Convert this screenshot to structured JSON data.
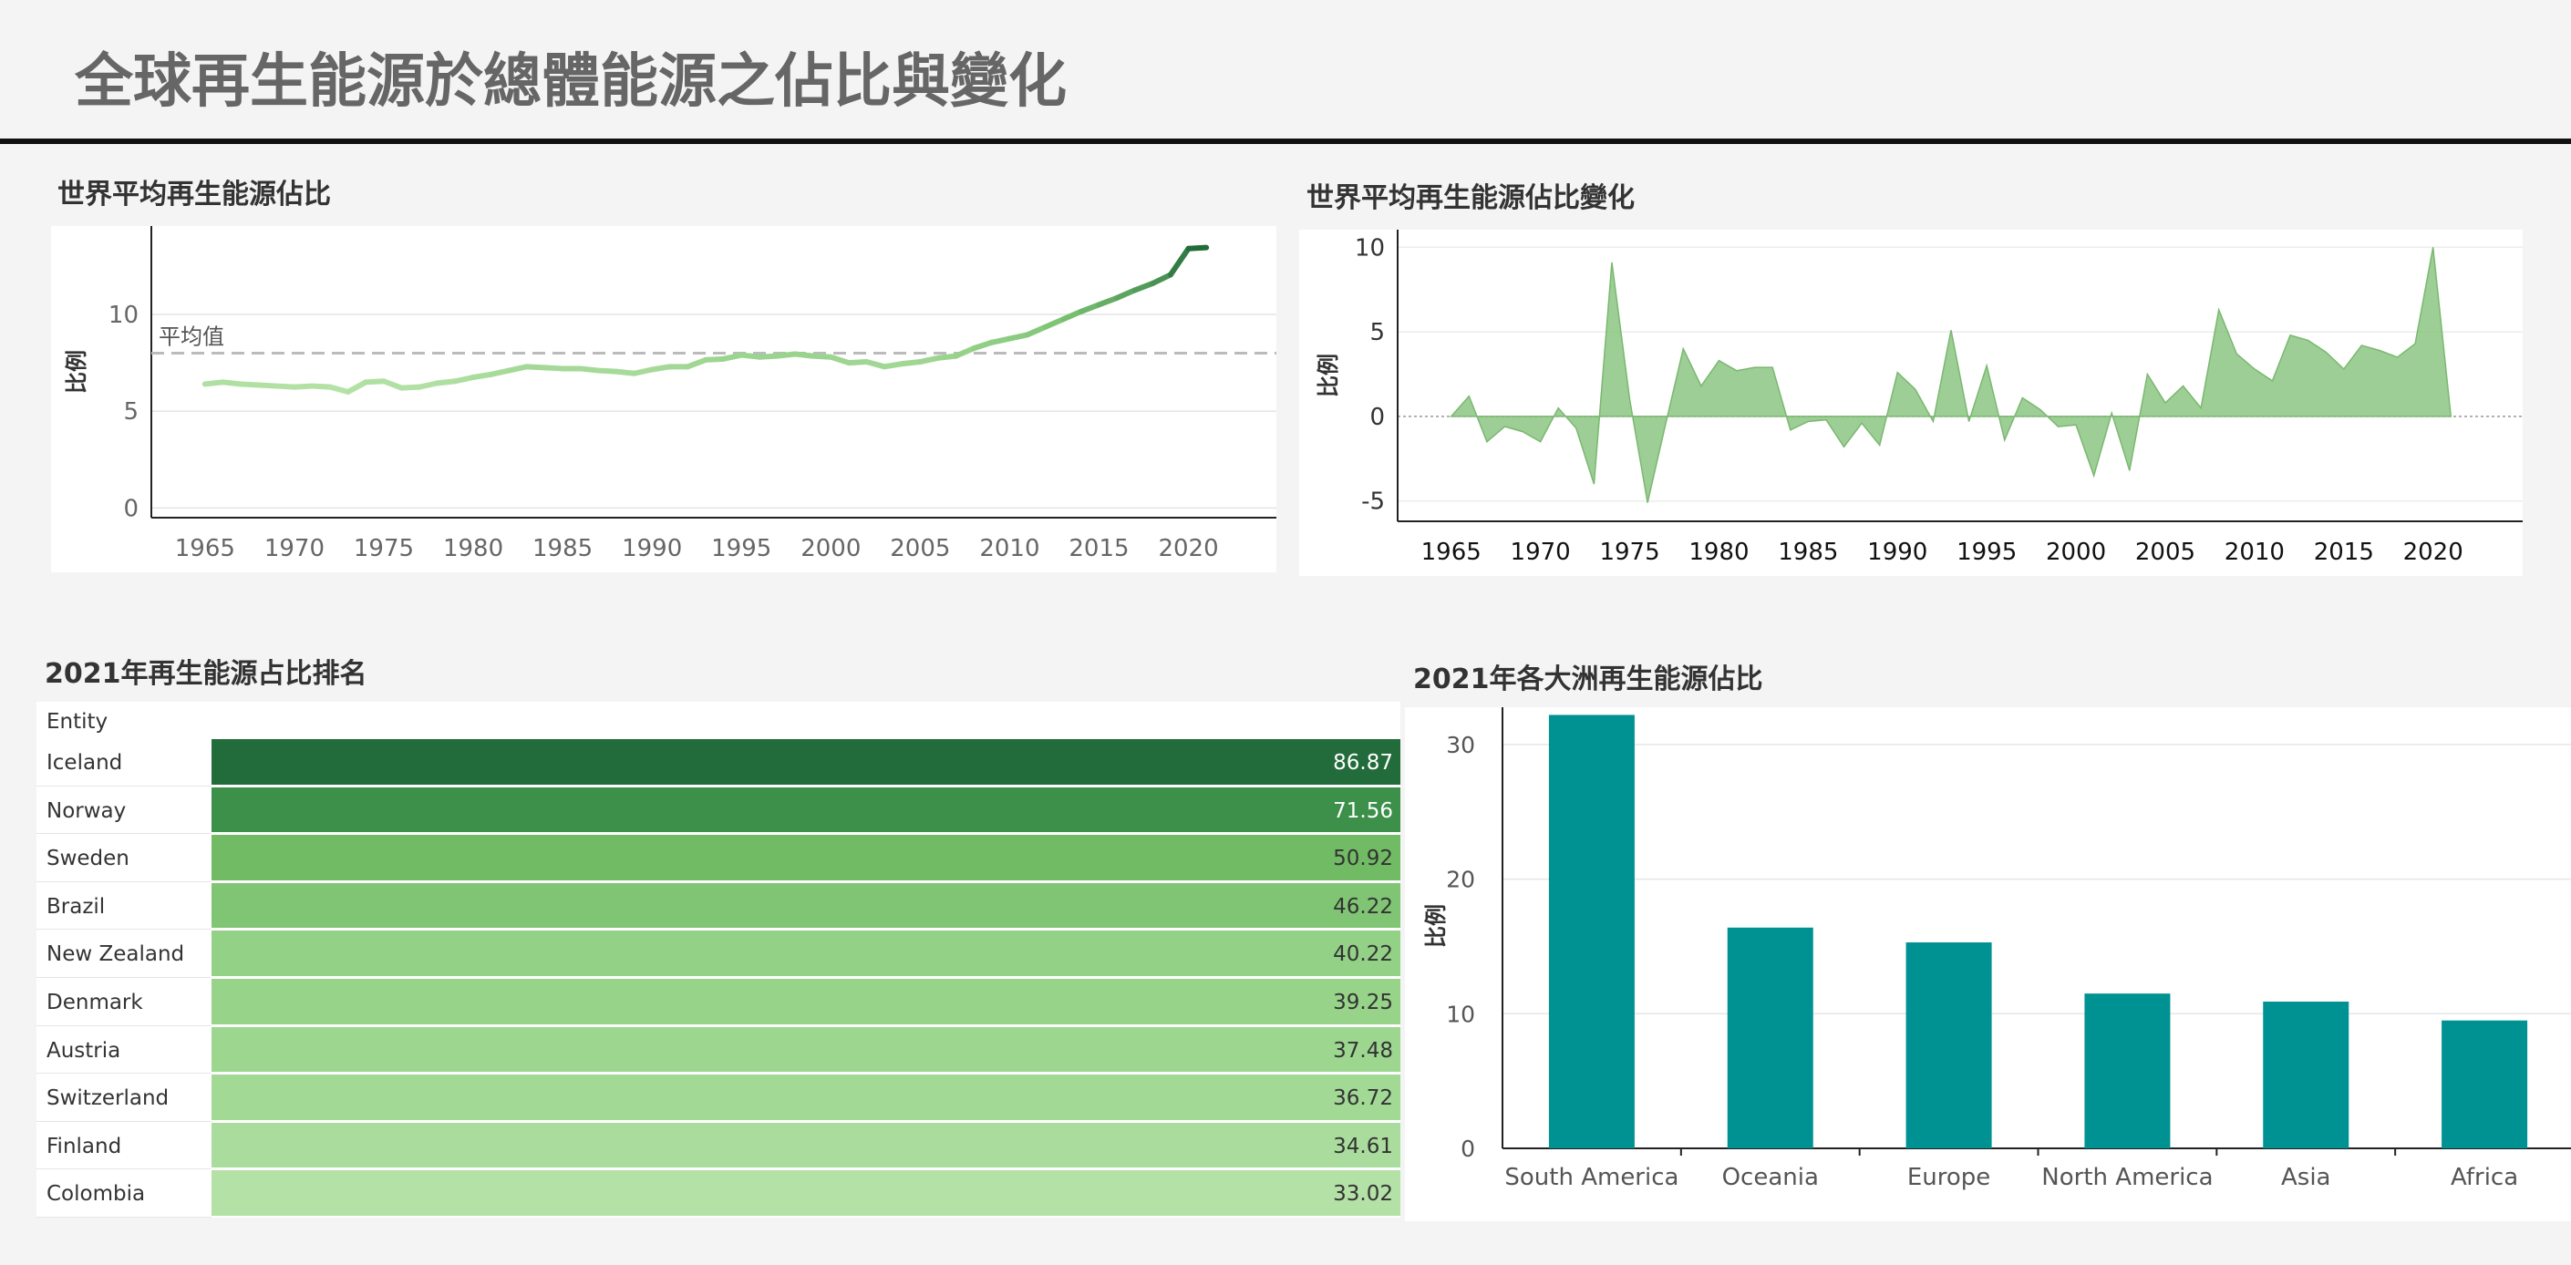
{
  "page": {
    "title": "全球再生能源於總體能源之佔比與變化"
  },
  "chart_data": [
    {
      "type": "line",
      "title": "世界平均再生能源佔比",
      "ylabel": "比例",
      "xlim": [
        1962,
        2024
      ],
      "ylim": [
        -0.5,
        14
      ],
      "xticks": [
        1965,
        1970,
        1975,
        1980,
        1985,
        1990,
        1995,
        2000,
        2005,
        2010,
        2015,
        2020
      ],
      "yticks": [
        0,
        5,
        10
      ],
      "reference_line": {
        "label": "平均值",
        "value": 8.0
      },
      "x": [
        1965,
        1966,
        1967,
        1968,
        1969,
        1970,
        1971,
        1972,
        1973,
        1974,
        1975,
        1976,
        1977,
        1978,
        1979,
        1980,
        1981,
        1982,
        1983,
        1984,
        1985,
        1986,
        1987,
        1988,
        1989,
        1990,
        1991,
        1992,
        1993,
        1994,
        1995,
        1996,
        1997,
        1998,
        1999,
        2000,
        2001,
        2002,
        2003,
        2004,
        2005,
        2006,
        2007,
        2008,
        2009,
        2010,
        2011,
        2012,
        2013,
        2014,
        2015,
        2016,
        2017,
        2018,
        2019,
        2020,
        2021
      ],
      "values": [
        6.4,
        6.5,
        6.4,
        6.35,
        6.3,
        6.25,
        6.3,
        6.25,
        6.0,
        6.5,
        6.55,
        6.2,
        6.25,
        6.45,
        6.55,
        6.75,
        6.9,
        7.1,
        7.3,
        7.25,
        7.2,
        7.2,
        7.1,
        7.05,
        6.95,
        7.15,
        7.3,
        7.3,
        7.65,
        7.7,
        7.9,
        7.8,
        7.85,
        7.95,
        7.85,
        7.8,
        7.5,
        7.55,
        7.3,
        7.45,
        7.55,
        7.75,
        7.85,
        8.25,
        8.55,
        8.75,
        8.95,
        9.35,
        9.75,
        10.15,
        10.5,
        10.85,
        11.25,
        11.6,
        12.05,
        13.4,
        13.45
      ],
      "colors": {
        "low": "#b7e3a8",
        "mid": "#7dc474",
        "high": "#216b3a"
      }
    },
    {
      "type": "area",
      "title": "世界平均再生能源佔比變化",
      "ylabel": "比例",
      "xlim": [
        1962,
        2024
      ],
      "ylim": [
        -6.2,
        10.5
      ],
      "xticks": [
        1965,
        1970,
        1975,
        1980,
        1985,
        1990,
        1995,
        2000,
        2005,
        2010,
        2015,
        2020
      ],
      "yticks": [
        -5,
        0,
        5,
        10
      ],
      "x": [
        1965,
        1966,
        1967,
        1968,
        1969,
        1970,
        1971,
        1972,
        1973,
        1974,
        1975,
        1976,
        1977,
        1978,
        1979,
        1980,
        1981,
        1982,
        1983,
        1984,
        1985,
        1986,
        1987,
        1988,
        1989,
        1990,
        1991,
        1992,
        1993,
        1994,
        1995,
        1996,
        1997,
        1998,
        1999,
        2000,
        2001,
        2002,
        2003,
        2004,
        2005,
        2006,
        2007,
        2008,
        2009,
        2010,
        2011,
        2012,
        2013,
        2014,
        2015,
        2016,
        2017,
        2018,
        2019,
        2020,
        2021
      ],
      "values": [
        0,
        1.2,
        -1.5,
        -0.6,
        -0.9,
        -1.5,
        0.5,
        -0.7,
        -4.0,
        9.1,
        1.0,
        -5.1,
        -0.5,
        4.0,
        1.8,
        3.3,
        2.7,
        2.9,
        2.9,
        -0.8,
        -0.3,
        -0.2,
        -1.8,
        -0.4,
        -1.7,
        2.6,
        1.6,
        -0.3,
        5.1,
        -0.3,
        3.0,
        -1.4,
        1.1,
        0.4,
        -0.6,
        -0.5,
        -3.5,
        0.2,
        -3.2,
        2.5,
        0.8,
        1.8,
        0.5,
        6.3,
        3.7,
        2.8,
        2.1,
        4.8,
        4.5,
        3.8,
        2.8,
        4.2,
        3.9,
        3.5,
        4.3,
        10.0,
        0
      ],
      "color": "#8cc583"
    },
    {
      "type": "table",
      "title": "2021年再生能源占比排名",
      "columns": [
        "Entity"
      ],
      "rows": [
        {
          "entity": "Iceland",
          "value": "86.87",
          "bg": "#226b3a",
          "fg": "#ffffff"
        },
        {
          "entity": "Norway",
          "value": "71.56",
          "bg": "#3c904a",
          "fg": "#ffffff"
        },
        {
          "entity": "Sweden",
          "value": "50.92",
          "bg": "#72bb65",
          "fg": "#333333"
        },
        {
          "entity": "Brazil",
          "value": "46.22",
          "bg": "#80c574",
          "fg": "#333333"
        },
        {
          "entity": "New Zealand",
          "value": "40.22",
          "bg": "#92d186",
          "fg": "#333333"
        },
        {
          "entity": "Denmark",
          "value": "39.25",
          "bg": "#97d48a",
          "fg": "#333333"
        },
        {
          "entity": "Austria",
          "value": "37.48",
          "bg": "#9cd68f",
          "fg": "#333333"
        },
        {
          "entity": "Switzerland",
          "value": "36.72",
          "bg": "#a2d995",
          "fg": "#333333"
        },
        {
          "entity": "Finland",
          "value": "34.61",
          "bg": "#aadd9d",
          "fg": "#333333"
        },
        {
          "entity": "Colombia",
          "value": "33.02",
          "bg": "#b3e1a6",
          "fg": "#333333"
        }
      ]
    },
    {
      "type": "bar",
      "title": "2021年各大洲再生能源佔比",
      "ylabel": "比例",
      "ylim": [
        0,
        32.5
      ],
      "yticks": [
        0,
        10,
        20,
        30
      ],
      "categories": [
        "South America",
        "Oceania",
        "Europe",
        "North America",
        "Asia",
        "Africa"
      ],
      "values": [
        32.2,
        16.4,
        15.3,
        11.5,
        10.9,
        9.5
      ],
      "color": "#009192"
    }
  ]
}
